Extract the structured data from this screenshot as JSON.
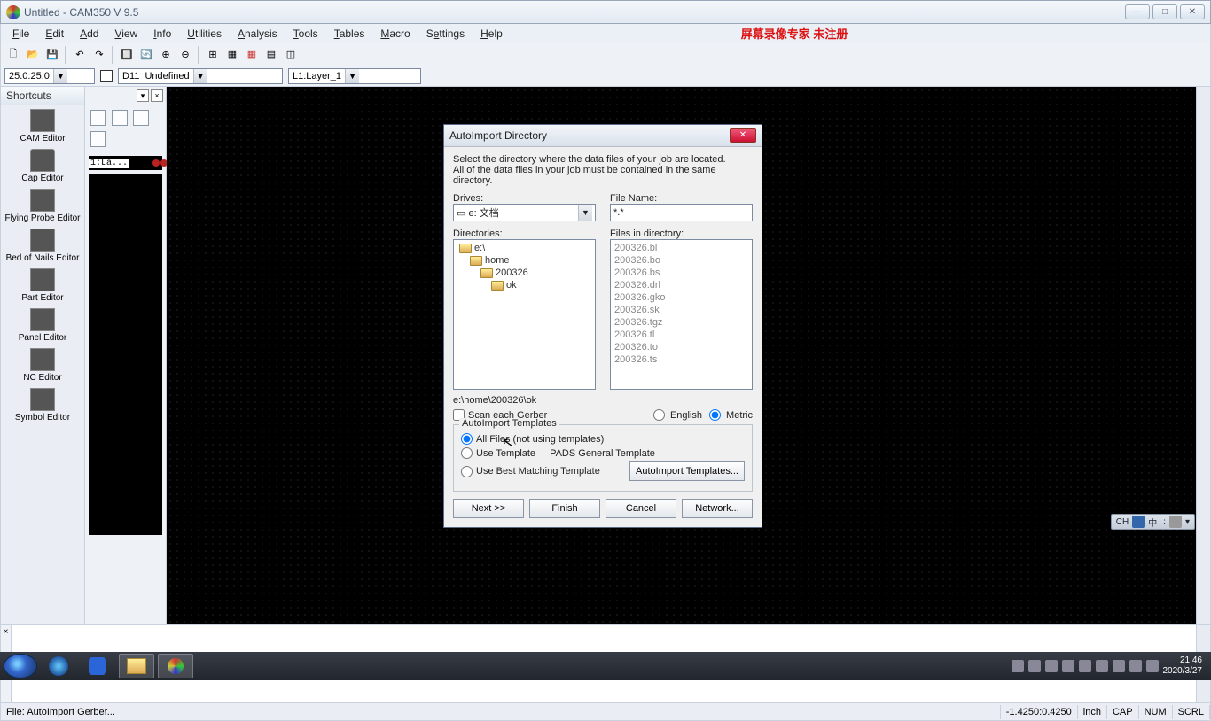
{
  "title": "Untitled - CAM350 V 9.5",
  "menus": [
    "File",
    "Edit",
    "Add",
    "View",
    "Info",
    "Utilities",
    "Analysis",
    "Tools",
    "Tables",
    "Macro",
    "Settings",
    "Help"
  ],
  "menu_underline_index": [
    0,
    0,
    0,
    0,
    0,
    0,
    0,
    0,
    0,
    0,
    1,
    0
  ],
  "watermark": "屏幕录像专家  未注册",
  "combo_coord": "25.0:25.0",
  "combo_dcode": "D11  Undefined",
  "combo_layer": "L1:Layer_1",
  "shortcuts_title": "Shortcuts",
  "shortcuts": [
    "CAM Editor",
    "Cap Editor",
    "Flying Probe Editor",
    "Bed of Nails Editor",
    "Part Editor",
    "Panel Editor",
    "NC Editor",
    "Symbol Editor"
  ],
  "shortcut_icon_cls": [
    "ic-cam",
    "ic-cap",
    "ic-fly",
    "ic-bed",
    "ic-part",
    "ic-panel",
    "ic-nc",
    "ic-sym"
  ],
  "layer_strip": "1:La...",
  "status_left": "File: AutoImport Gerber...",
  "status_coord": "-1.4250:0.4250",
  "status_units": "inch",
  "status_flags": [
    "CAP",
    "NUM",
    "SCRL"
  ],
  "langbar": [
    "CH",
    "",
    "中",
    ":",
    "",
    ""
  ],
  "clock_time": "21:46",
  "clock_date": "2020/3/27",
  "dialog": {
    "title": "AutoImport Directory",
    "intro1": "Select the directory where the data files of your job are located.",
    "intro2": "All of the data files in your job must be contained in the same directory.",
    "drives_label": "Drives:",
    "drive_value": "e: 文档",
    "filename_label": "File Name:",
    "filename_value": "*.*",
    "directories_label": "Directories:",
    "dirs": [
      "e:\\",
      "home",
      "200326",
      "ok"
    ],
    "files_label": "Files in directory:",
    "files": [
      "200326.bl",
      "200326.bo",
      "200326.bs",
      "200326.drl",
      "200326.gko",
      "200326.sk",
      "200326.tgz",
      "200326.tl",
      "200326.to",
      "200326.ts"
    ],
    "path": "e:\\home\\200326\\ok",
    "scan_gerber": "Scan each Gerber",
    "unit_english": "English",
    "unit_metric": "Metric",
    "templates_legend": "AutoImport Templates",
    "tpl_all": "All Files (not using templates)",
    "tpl_use": "Use Template",
    "tpl_use_name": "PADS General Template",
    "tpl_best": "Use Best Matching Template",
    "tpl_btn": "AutoImport Templates...",
    "btn_next": "Next  >>",
    "btn_finish": "Finish",
    "btn_cancel": "Cancel",
    "btn_network": "Network..."
  }
}
